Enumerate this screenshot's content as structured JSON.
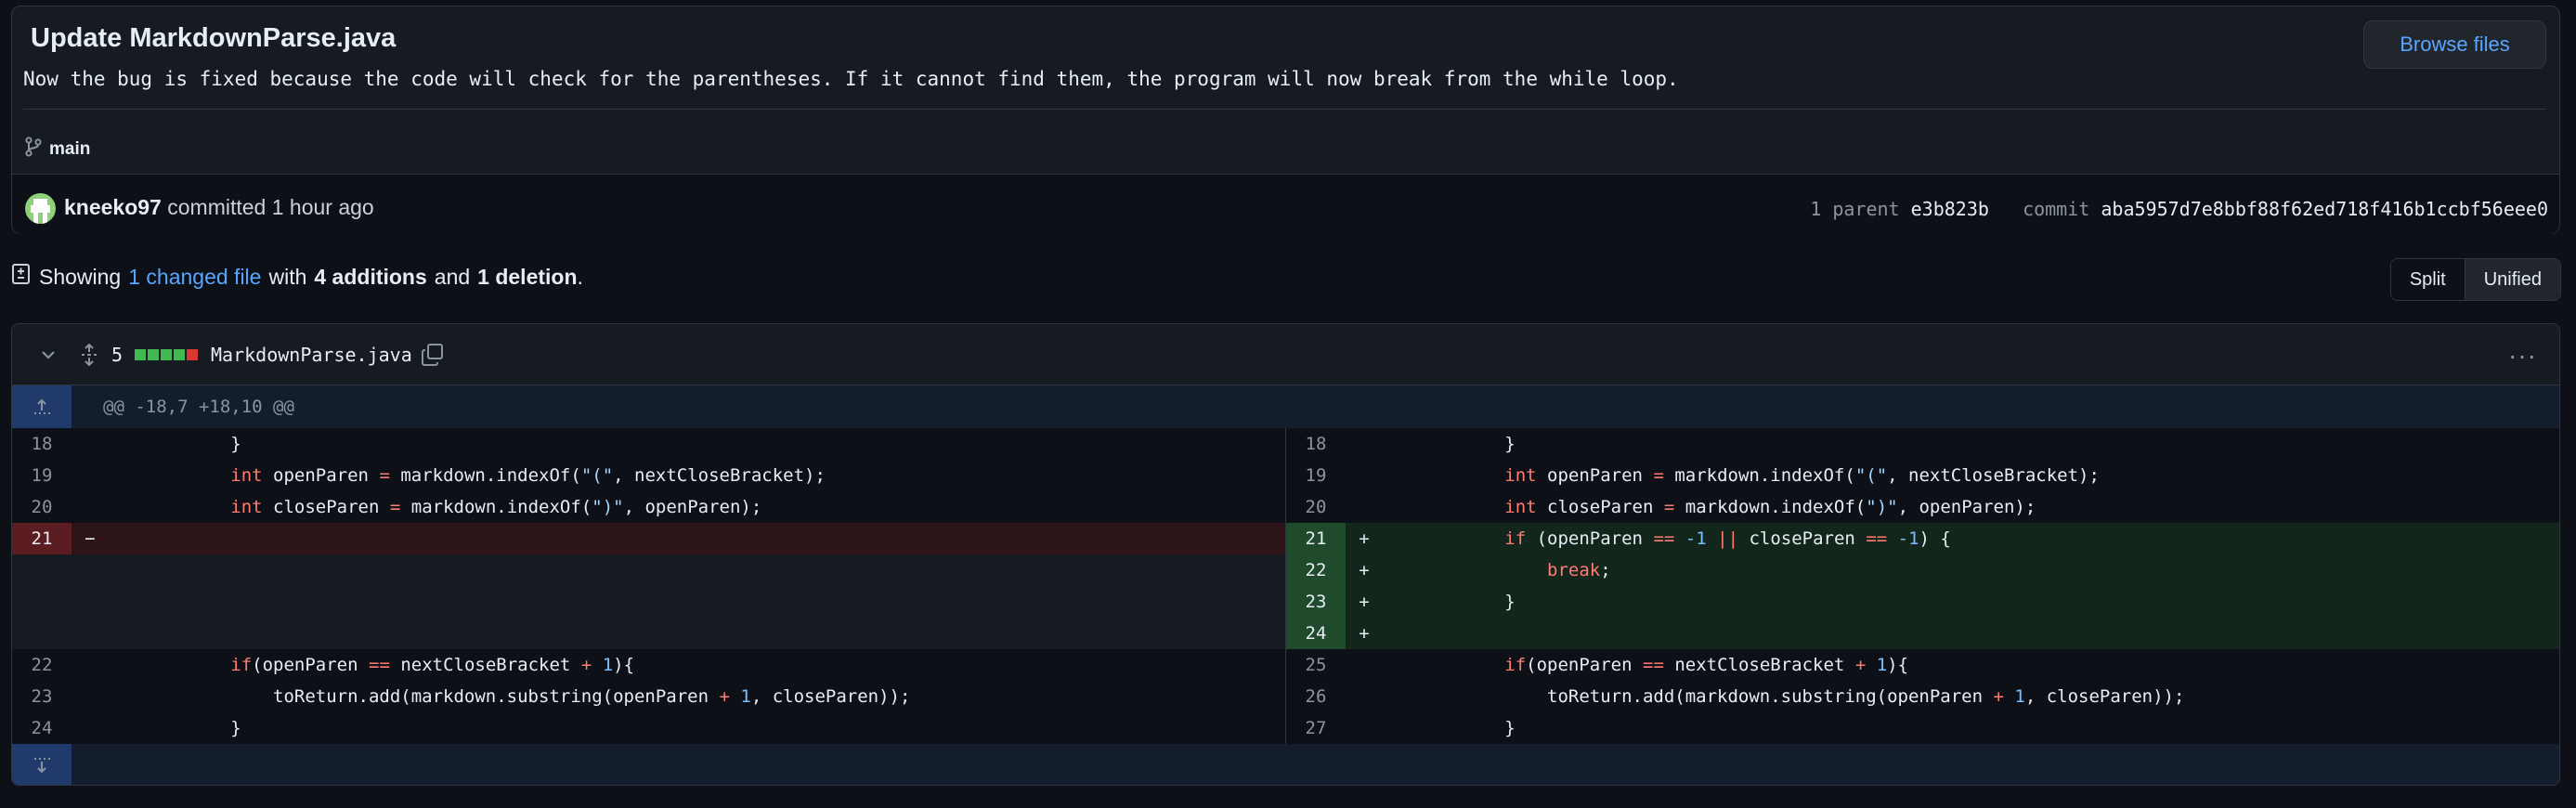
{
  "commit": {
    "title": "Update MarkdownParse.java",
    "description": "Now the bug is fixed because the code will check for the parentheses. If it cannot find them, the program will now break from the while loop.",
    "browse_label": "Browse files",
    "branch": "main",
    "author": "kneeko97",
    "committed_text": "committed 1 hour ago",
    "parent_label": "1 parent",
    "parent_sha": "e3b823b",
    "commit_label": "commit",
    "commit_sha": "aba5957d7e8bbf88f62ed718f416b1ccbf56eee0"
  },
  "summary": {
    "showing": "Showing",
    "changed_link": "1 changed file",
    "with": "with",
    "additions": "4 additions",
    "and": "and",
    "deletions": "1 deletion",
    "period": "."
  },
  "view_toggle": {
    "split": "Split",
    "unified": "Unified"
  },
  "file": {
    "change_count": "5",
    "name": "MarkdownParse.java",
    "diffstat": [
      "add",
      "add",
      "add",
      "add",
      "del"
    ],
    "hunk_header": "@@ -18,7 +18,10 @@"
  },
  "colors": {
    "accent": "#58a6ff",
    "addition": "#3fb950",
    "deletion": "#da3633"
  },
  "icons": [
    "git-branch-icon",
    "avatar",
    "file-diff-icon",
    "chevron-down-icon",
    "unfold-icon",
    "copy-icon",
    "kebab-menu-icon",
    "expand-up-icon",
    "expand-down-icon"
  ],
  "left_lines": [
    {
      "num": "18",
      "code": "            }"
    },
    {
      "num": "19",
      "code": "            int openParen = markdown.indexOf(\"(\", nextCloseBracket);"
    },
    {
      "num": "20",
      "code": "            int closeParen = markdown.indexOf(\")\", openParen);"
    },
    {
      "num": "21",
      "code": "",
      "sign": "−"
    },
    {
      "num": "22",
      "code": "            if(openParen == nextCloseBracket + 1){"
    },
    {
      "num": "23",
      "code": "                toReturn.add(markdown.substring(openParen + 1, closeParen));"
    },
    {
      "num": "24",
      "code": "            }"
    }
  ],
  "right_lines": [
    {
      "num": "18",
      "code": "            }"
    },
    {
      "num": "19",
      "code": "            int openParen = markdown.indexOf(\"(\", nextCloseBracket);"
    },
    {
      "num": "20",
      "code": "            int closeParen = markdown.indexOf(\")\", openParen);"
    },
    {
      "num": "21",
      "code": "            if (openParen == -1 || closeParen == -1) {",
      "sign": "+"
    },
    {
      "num": "22",
      "code": "                break;",
      "sign": "+"
    },
    {
      "num": "23",
      "code": "            }",
      "sign": "+"
    },
    {
      "num": "24",
      "code": "",
      "sign": "+"
    },
    {
      "num": "25",
      "code": "            if(openParen == nextCloseBracket + 1){"
    },
    {
      "num": "26",
      "code": "                toReturn.add(markdown.substring(openParen + 1, closeParen));"
    },
    {
      "num": "27",
      "code": "            }"
    }
  ]
}
